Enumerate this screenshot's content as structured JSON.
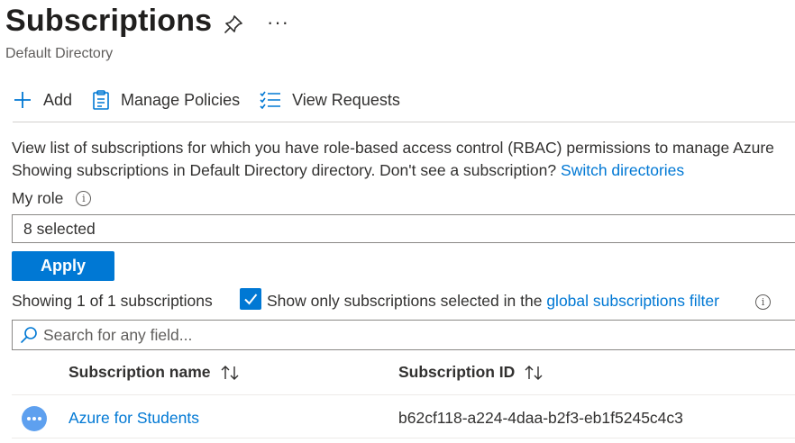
{
  "header": {
    "title": "Subscriptions",
    "subtitle": "Default Directory",
    "pin_icon": "pin-icon",
    "more_label": "···"
  },
  "toolbar": {
    "add_label": "Add",
    "manage_policies_label": "Manage Policies",
    "view_requests_label": "View Requests"
  },
  "description": {
    "line1": "View list of subscriptions for which you have role-based access control (RBAC) permissions to manage Azure",
    "line2_prefix": "Showing subscriptions in Default Directory directory. Don't see a subscription?",
    "switch_link": "Switch directories"
  },
  "role_filter": {
    "label": "My role",
    "value": "8 selected"
  },
  "apply_label": "Apply",
  "summary": {
    "showing_text": "Showing 1 of 1 subscriptions",
    "checkbox_checked": true,
    "checkbox_text": "Show only subscriptions selected in the",
    "filter_link": "global subscriptions filter"
  },
  "search": {
    "placeholder": "Search for any field..."
  },
  "table": {
    "columns": [
      "Subscription name",
      "Subscription ID"
    ],
    "rows": [
      {
        "name": "Azure for Students",
        "id": "b62cf118-a224-4daa-b2f3-eb1f5245c4c3"
      }
    ]
  },
  "colors": {
    "accent": "#0078d4",
    "row_icon": "#5ea0ef"
  }
}
